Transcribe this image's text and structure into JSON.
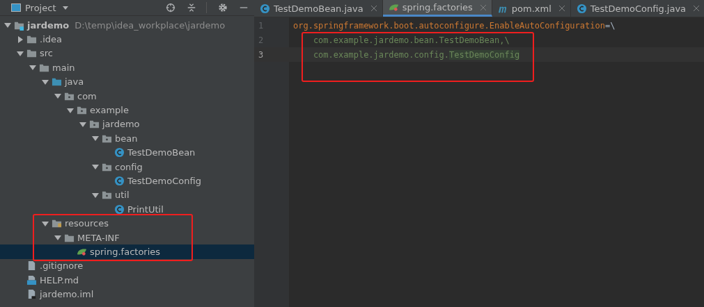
{
  "project_panel": {
    "title": "Project",
    "highlight_box": true,
    "tree": [
      {
        "name": "jardemo",
        "path": "D:\\temp\\idea_workplace\\jardemo",
        "kind": "module",
        "expanded": true,
        "selected": false,
        "children": [
          {
            "name": ".idea",
            "kind": "folder",
            "expanded": false,
            "selected": false
          },
          {
            "name": "src",
            "kind": "folder",
            "expanded": true,
            "selected": false,
            "children": [
              {
                "name": "main",
                "kind": "folder",
                "expanded": true,
                "selected": false,
                "children": [
                  {
                    "name": "java",
                    "kind": "source",
                    "expanded": true,
                    "selected": false,
                    "children": [
                      {
                        "name": "com",
                        "kind": "package",
                        "expanded": true,
                        "selected": false,
                        "children": [
                          {
                            "name": "example",
                            "kind": "package",
                            "expanded": true,
                            "selected": false,
                            "children": [
                              {
                                "name": "jardemo",
                                "kind": "package",
                                "expanded": true,
                                "selected": false,
                                "children": [
                                  {
                                    "name": "bean",
                                    "kind": "package",
                                    "expanded": true,
                                    "selected": false,
                                    "children": [
                                      {
                                        "name": "TestDemoBean",
                                        "kind": "class",
                                        "selected": false
                                      }
                                    ]
                                  },
                                  {
                                    "name": "config",
                                    "kind": "package",
                                    "expanded": true,
                                    "selected": false,
                                    "children": [
                                      {
                                        "name": "TestDemoConfig",
                                        "kind": "class",
                                        "selected": false
                                      }
                                    ]
                                  },
                                  {
                                    "name": "util",
                                    "kind": "package",
                                    "expanded": true,
                                    "selected": false,
                                    "children": [
                                      {
                                        "name": "PrintUtil",
                                        "kind": "class",
                                        "selected": false
                                      }
                                    ]
                                  }
                                ]
                              }
                            ]
                          }
                        ]
                      }
                    ]
                  },
                  {
                    "name": "resources",
                    "kind": "resources",
                    "expanded": true,
                    "selected": false,
                    "children": [
                      {
                        "name": "META-INF",
                        "kind": "folder",
                        "expanded": true,
                        "selected": false,
                        "children": [
                          {
                            "name": "spring.factories",
                            "kind": "spring",
                            "selected": true
                          }
                        ]
                      }
                    ]
                  }
                ]
              }
            ]
          },
          {
            "name": ".gitignore",
            "kind": "ignore",
            "selected": false
          },
          {
            "name": "HELP.md",
            "kind": "markdown",
            "selected": false
          },
          {
            "name": "jardemo.iml",
            "kind": "iml",
            "selected": false
          }
        ]
      }
    ]
  },
  "editor": {
    "highlight_box": true,
    "tabs": [
      {
        "label": "TestDemoBean.java",
        "kind": "class",
        "selected": false
      },
      {
        "label": "spring.factories",
        "kind": "spring",
        "selected": true
      },
      {
        "label": "pom.xml",
        "kind": "maven",
        "selected": false
      },
      {
        "label": "TestDemoConfig.java",
        "kind": "class",
        "selected": false
      }
    ],
    "lines": [
      {
        "number": "1",
        "current": false,
        "tokens": [
          {
            "text": "org.springframework.boot.autoconfigure.EnableAutoConfiguration",
            "kind": "key"
          },
          {
            "text": "=\\",
            "kind": "op"
          }
        ]
      },
      {
        "number": "2",
        "current": false,
        "tokens": [
          {
            "text": "    com.example.jardemo.bean.TestDemoBean,\\",
            "kind": "value"
          }
        ]
      },
      {
        "number": "3",
        "current": true,
        "tokens": [
          {
            "text": "    com.example.jardemo.config.",
            "kind": "value"
          },
          {
            "text": "TestDemoConfig",
            "kind": "match"
          }
        ]
      }
    ]
  }
}
